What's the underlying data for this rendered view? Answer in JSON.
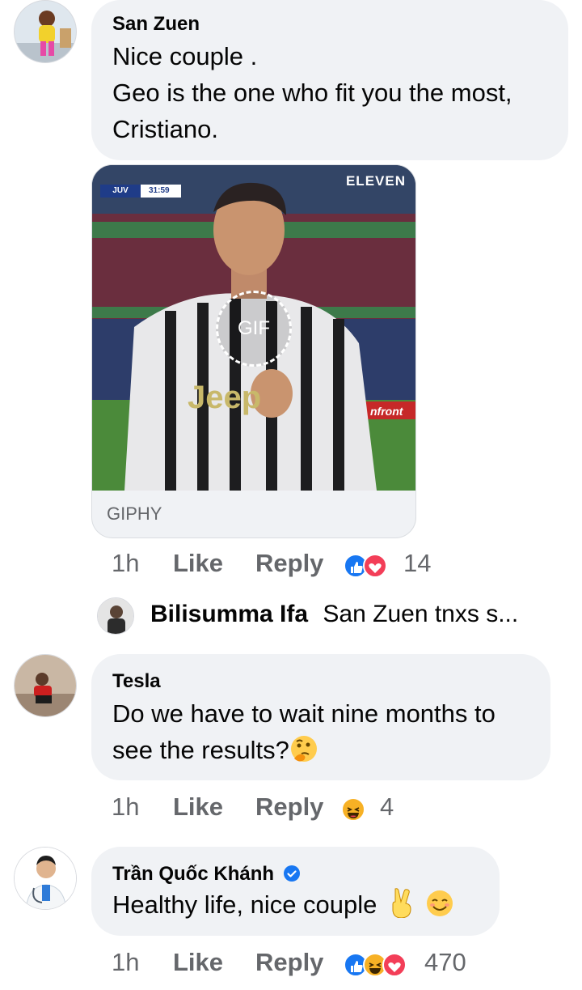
{
  "comments": [
    {
      "author": "San Zuen",
      "lines": [
        "Nice couple .",
        "Geo is the one who fit you the most,",
        "Cristiano."
      ],
      "gif": {
        "caption": "GIPHY",
        "badge": "GIF",
        "scoreboard_team": "JUV",
        "scoreboard_time": "31:59",
        "broadcaster": "ELEVEN",
        "jersey_text": "Jeep",
        "board_text": "nfront"
      },
      "time": "1h",
      "like_label": "Like",
      "reply_label": "Reply",
      "reaction_count": "14",
      "reactions": [
        "like",
        "love"
      ]
    },
    {
      "reply_preview": {
        "author": "Bilisumma Ifa",
        "text": "San Zuen tnxs s..."
      }
    },
    {
      "author": "Tesla",
      "lines": [
        "Do we have to wait nine months to",
        "see the results?"
      ],
      "emoji": "thinking-face",
      "time": "1h",
      "like_label": "Like",
      "reply_label": "Reply",
      "reaction_count": "4",
      "reactions": [
        "haha"
      ]
    },
    {
      "author": "Trần Quốc Khánh",
      "verified": true,
      "lines": [
        "Healthy life, nice couple"
      ],
      "emojis": [
        "victory-hand",
        "smiling-face"
      ],
      "time": "1h",
      "like_label": "Like",
      "reply_label": "Reply",
      "reaction_count": "470",
      "reactions": [
        "like",
        "haha",
        "love"
      ]
    }
  ],
  "colors": {
    "bubble": "#f0f2f5",
    "secondary_text": "#65676b",
    "like_blue": "#1877f2",
    "love_red": "#f33e58",
    "haha_yellow": "#f7b125"
  }
}
